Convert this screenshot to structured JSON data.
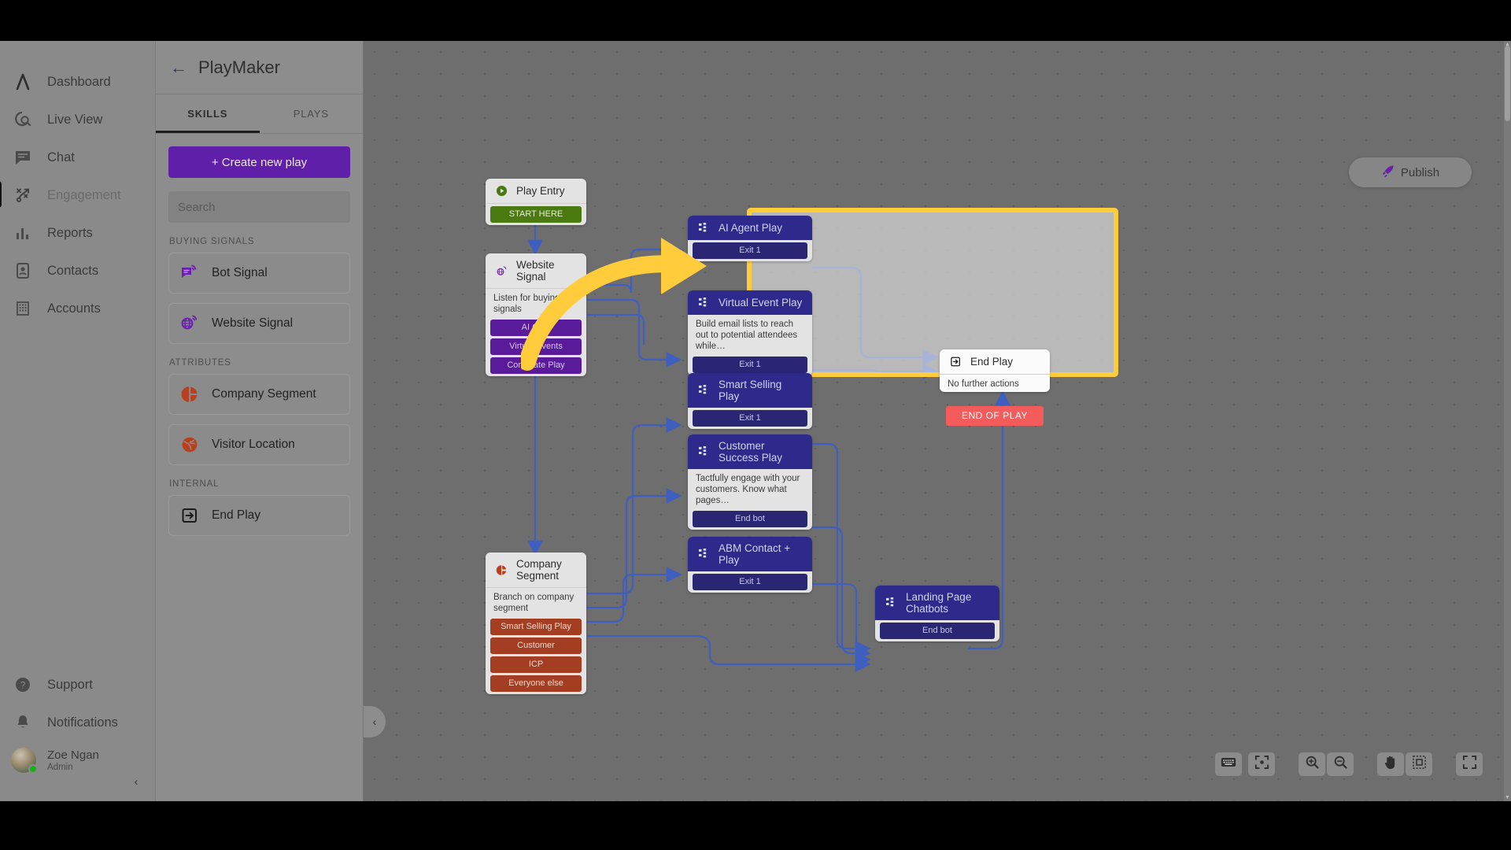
{
  "rail": {
    "items": [
      {
        "label": "Dashboard",
        "icon": "lambda-logo-icon",
        "active": false
      },
      {
        "label": "Live View",
        "icon": "live-view-icon",
        "active": false
      },
      {
        "label": "Chat",
        "icon": "chat-icon",
        "active": false
      },
      {
        "label": "Engagement",
        "icon": "engagement-playbook-icon",
        "active": true
      },
      {
        "label": "Reports",
        "icon": "bar-chart-icon",
        "active": false
      },
      {
        "label": "Contacts",
        "icon": "contacts-icon",
        "active": false
      },
      {
        "label": "Accounts",
        "icon": "accounts-building-icon",
        "active": false
      }
    ],
    "bottom": [
      {
        "label": "Support",
        "icon": "help-circle-icon"
      },
      {
        "label": "Notifications",
        "icon": "bell-icon"
      }
    ],
    "user": {
      "name": "Zoe Ngan",
      "role": "Admin",
      "status": "online"
    },
    "collapse_glyph": "‹"
  },
  "panel": {
    "back_glyph": "←",
    "title": "PlayMaker",
    "tabs": [
      {
        "label": "SKILLS",
        "active": true
      },
      {
        "label": "PLAYS",
        "active": false
      }
    ],
    "create_button": "+ Create new play",
    "search_placeholder": "Search",
    "search_value": "",
    "groups": [
      {
        "label": "BUYING SIGNALS",
        "items": [
          {
            "label": "Bot Signal",
            "icon": "bot-signal-icon"
          },
          {
            "label": "Website Signal",
            "icon": "website-signal-globe-icon"
          }
        ]
      },
      {
        "label": "ATTRIBUTES",
        "items": [
          {
            "label": "Company Segment",
            "icon": "company-segment-pie-icon"
          },
          {
            "label": "Visitor Location",
            "icon": "visitor-location-globe-icon"
          }
        ]
      },
      {
        "label": "INTERNAL",
        "items": [
          {
            "label": "End Play",
            "icon": "end-play-exit-icon"
          }
        ]
      }
    ]
  },
  "canvas": {
    "publish_label": "Publish",
    "publish_icon": "rocket-icon",
    "collapse_glyph": "‹",
    "nodes": {
      "play_entry": {
        "title": "Play Entry",
        "icon": "play-circle-icon",
        "exits": [
          "START HERE"
        ]
      },
      "website_signal": {
        "title": "Website Signal",
        "icon": "website-signal-globe-icon",
        "desc": "Listen for buying signals",
        "exits": [
          "AI Chat",
          "Virtual Events",
          "Corporate Play"
        ]
      },
      "company_segment": {
        "title": "Company Segment",
        "icon": "company-segment-pie-icon",
        "desc": "Branch on company segment",
        "exits": [
          "Smart Selling Play",
          "Customer",
          "ICP",
          "Everyone else"
        ]
      },
      "ai_agent_play": {
        "title": "AI Agent Play",
        "icon": "play-node-icon",
        "exits": [
          "Exit 1"
        ]
      },
      "virtual_event_play": {
        "title": "Virtual Event Play",
        "icon": "play-node-icon",
        "desc": "Build email lists to reach out to potential attendees while…",
        "exits": [
          "Exit 1"
        ]
      },
      "smart_selling_play": {
        "title": "Smart Selling Play",
        "icon": "play-node-icon",
        "exits": [
          "Exit 1"
        ]
      },
      "customer_success_play": {
        "title": "Customer Success Play",
        "icon": "play-node-icon",
        "desc": "Tactfully engage with your customers. Know what pages…",
        "exits": [
          "End bot"
        ]
      },
      "abm_contact_play": {
        "title": "ABM Contact + Play",
        "icon": "play-node-icon",
        "exits": [
          "Exit 1"
        ]
      },
      "landing_page_chatbots": {
        "title": "Landing Page Chatbots",
        "icon": "play-node-icon",
        "exits": [
          "End bot"
        ]
      },
      "end_play": {
        "title": "End Play",
        "icon": "end-play-exit-icon",
        "desc": "No further actions",
        "exits": [
          "END OF PLAY"
        ]
      }
    },
    "toolbar": [
      {
        "name": "keyboard-shortcuts-button",
        "icon": "keyboard-icon"
      },
      {
        "name": "center-view-button",
        "icon": "focus-target-icon"
      },
      {
        "name": "zoom-in-button",
        "icon": "zoom-in-icon"
      },
      {
        "name": "zoom-out-button",
        "icon": "zoom-out-icon"
      },
      {
        "name": "pan-tool-button",
        "icon": "hand-icon"
      },
      {
        "name": "select-tool-button",
        "icon": "marquee-select-icon"
      },
      {
        "name": "fullscreen-button",
        "icon": "fullscreen-icon"
      }
    ]
  },
  "colors": {
    "brand_purple": "#5f1fa8",
    "highlight_yellow": "#ffcd3c",
    "play_navy": "#2e2a8c",
    "segment_orange": "#a33e22",
    "entry_green": "#4a7a10",
    "end_red": "#f45b5b",
    "link_blue": "#3f5fc0"
  }
}
